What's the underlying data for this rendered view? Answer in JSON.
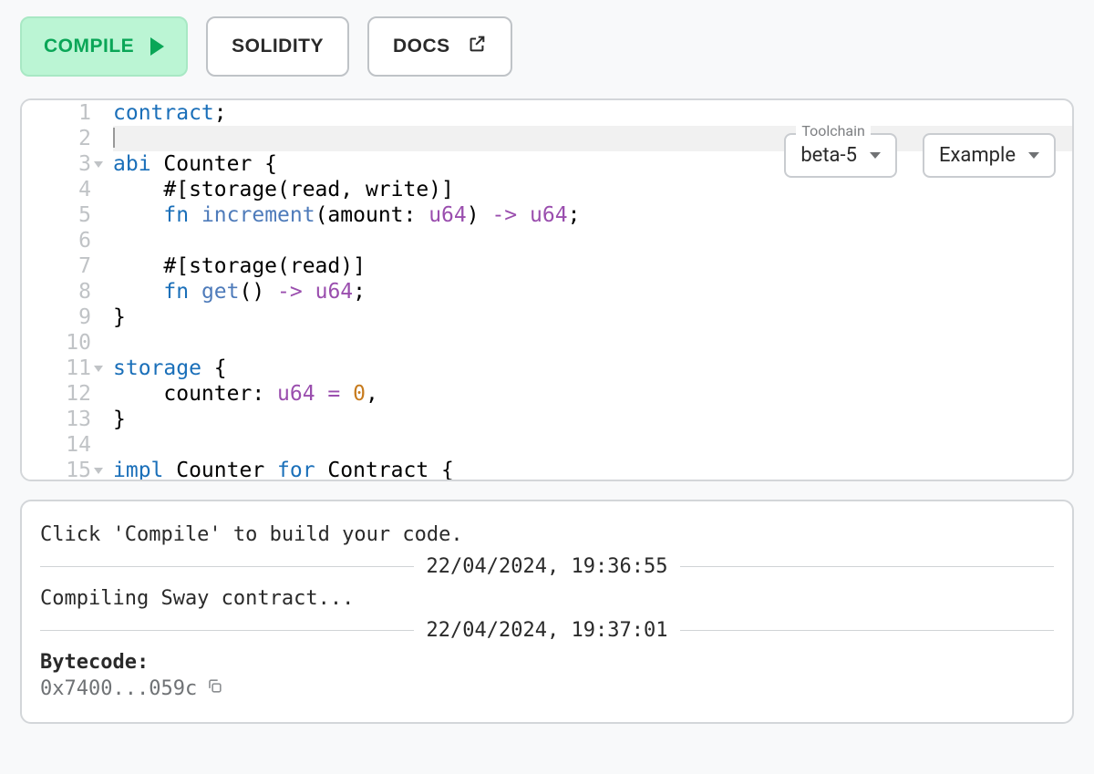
{
  "toolbar": {
    "compile_label": "COMPILE",
    "solidity_label": "SOLIDITY",
    "docs_label": "DOCS"
  },
  "selects": {
    "toolchain_legend": "Toolchain",
    "toolchain_value": "beta-5",
    "example_label": "Example"
  },
  "editor": {
    "lines": [
      {
        "num": "1",
        "fold": false
      },
      {
        "num": "2",
        "fold": false
      },
      {
        "num": "3",
        "fold": true
      },
      {
        "num": "4",
        "fold": false
      },
      {
        "num": "5",
        "fold": false
      },
      {
        "num": "6",
        "fold": false
      },
      {
        "num": "7",
        "fold": false
      },
      {
        "num": "8",
        "fold": false
      },
      {
        "num": "9",
        "fold": false
      },
      {
        "num": "10",
        "fold": false
      },
      {
        "num": "11",
        "fold": true
      },
      {
        "num": "12",
        "fold": false
      },
      {
        "num": "13",
        "fold": false
      },
      {
        "num": "14",
        "fold": false
      },
      {
        "num": "15",
        "fold": true
      }
    ],
    "tokens": {
      "l1_a": "contract",
      "l1_b": ";",
      "l3_a": "abi",
      "l3_b": " Counter {",
      "l4_a": "    #[storage(read, write)]",
      "l5_a": "    ",
      "l5_kw": "fn",
      "l5_sp": " ",
      "l5_fn": "increment",
      "l5_b": "(amount: ",
      "l5_ty": "u64",
      "l5_c": ") ",
      "l5_ar": "->",
      "l5_d": " ",
      "l5_ty2": "u64",
      "l5_e": ";",
      "l7_a": "    #[storage(read)]",
      "l8_a": "    ",
      "l8_kw": "fn",
      "l8_sp": " ",
      "l8_fn": "get",
      "l8_b": "() ",
      "l8_ar": "->",
      "l8_c": " ",
      "l8_ty": "u64",
      "l8_d": ";",
      "l9_a": "}",
      "l11_a": "storage",
      "l11_b": " {",
      "l12_a": "    counter: ",
      "l12_ty": "u64",
      "l12_sp": " ",
      "l12_eq": "=",
      "l12_sp2": " ",
      "l12_n": "0",
      "l12_c": ",",
      "l13_a": "}",
      "l15_a": "impl",
      "l15_b": " Counter ",
      "l15_for": "for",
      "l15_c": " Contract {"
    }
  },
  "output": {
    "msg1": "Click 'Compile' to build your code.",
    "ts1": "22/04/2024, 19:36:55",
    "msg2": "Compiling Sway contract...",
    "ts2": "22/04/2024, 19:37:01",
    "bytecode_label": "Bytecode:",
    "bytecode_value": "0x7400...059c"
  }
}
